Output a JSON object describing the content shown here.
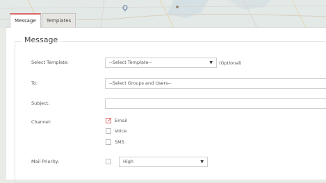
{
  "tabs": [
    {
      "label": "Message",
      "active": true
    },
    {
      "label": "Templates",
      "active": false
    }
  ],
  "section": {
    "title": "Message"
  },
  "form": {
    "template": {
      "label": "Select Template:",
      "value": "--Select Template--",
      "hint": "(Optional)"
    },
    "to": {
      "label": "To:",
      "value": "--Select Groups and Users--"
    },
    "subject": {
      "label": "Subject:",
      "value": ""
    },
    "channel": {
      "label": "Channel:",
      "options": [
        {
          "label": "Email",
          "checked": true
        },
        {
          "label": "Voice",
          "checked": false
        },
        {
          "label": "SMS",
          "checked": false
        }
      ]
    },
    "mail_priority": {
      "label": "Mail Priority:",
      "value": "High",
      "enabled": false
    }
  },
  "colors": {
    "accent": "#d96666",
    "border": "#cfcfcf"
  },
  "icons": {
    "map_pin": "map-pin-icon",
    "dropdown": "chevron-down-icon",
    "check": "check-icon"
  }
}
